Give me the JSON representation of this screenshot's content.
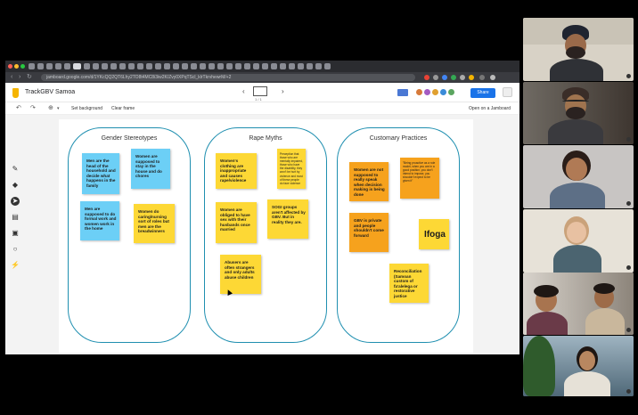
{
  "browser": {
    "url": "jamboard.google.com/d/1YKcQQ2QT6Lhy2TO8t4MC8i3iw2K/Zvy0XPqTScl_klrTkrvhewrM/+2",
    "tab_count": 34
  },
  "jamboard": {
    "title": "TrackGBV Samoa",
    "share_label": "Share",
    "set_background_label": "Set background",
    "clear_frame_label": "Clear frame",
    "open_on_jamboard_label": "Open on a Jamboard",
    "frame_counter": "1 / 1"
  },
  "columns": [
    {
      "title": "Gender Stereotypes"
    },
    {
      "title": "Rape Myths"
    },
    {
      "title": "Customary Practices"
    }
  ],
  "notes": {
    "gender_stereotypes": [
      {
        "text": "Men are the head of the household and decide what happens in the family",
        "color": "#6ccff6"
      },
      {
        "text": "Women are supposed to stay in the house and do chores",
        "color": "#6ccff6"
      },
      {
        "text": "Men are supposed to do formal work and women work in the home",
        "color": "#6ccff6"
      },
      {
        "text": "Women do caring/nursing sort of roles but men are the breadwinners",
        "color": "#fdd835"
      }
    ],
    "rape_myths": [
      {
        "text": "Women's clothing are inappropriate and causes rape/violence",
        "color": "#fdd835"
      },
      {
        "text": "Perception that those who are mentally impaired, those who have the disability, they won't be hurt by violence and most of these people do face violence",
        "color": "#fdd835"
      },
      {
        "text": "Women are obliged to have sex with their husbands once married",
        "color": "#fdd835"
      },
      {
        "text": "SOGI groups aren't affected by GBV. But in reality they are.",
        "color": "#fdd835"
      },
      {
        "text": "Abusers are often strangers and only adults abuse children",
        "color": "#fdd835"
      }
    ],
    "customary_practices": [
      {
        "text": "Women are not supposed to really speak when decision making is being done",
        "color": "#f6a21d"
      },
      {
        "text": "\"Being proactive as a role model, when you are in a good position, you don't intend to impose, you shouldn't expect to be given it\"",
        "color": "#f6a21d"
      },
      {
        "text": "GBV is private and people shouldn't come forward",
        "color": "#f6a21d"
      },
      {
        "text": "Ifoga",
        "color": "#fdd835"
      },
      {
        "text": "Reconciliation (Samoan custom of fa'alelega or restorative justice",
        "color": "#fdd835"
      }
    ]
  },
  "icons": {
    "toolbar": [
      "undo-icon",
      "redo-icon",
      "zoom-icon",
      "dropdown-icon"
    ],
    "rail": [
      "pen-icon",
      "eraser-icon",
      "select-icon",
      "sticky-note-icon",
      "image-icon",
      "circle-icon",
      "laser-icon"
    ]
  },
  "participants": [
    {
      "name": "participant-1"
    },
    {
      "name": "participant-2"
    },
    {
      "name": "participant-3"
    },
    {
      "name": "participant-4"
    },
    {
      "name": "participant-5"
    },
    {
      "name": "participant-6"
    }
  ]
}
